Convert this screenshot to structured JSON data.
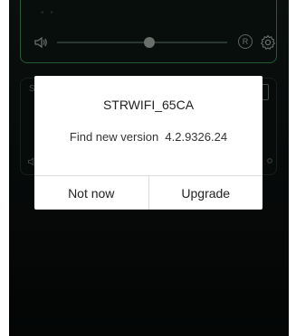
{
  "dialog": {
    "title": "STRWIFI_65CA",
    "message": "Find new version  4.2.9326.24",
    "buttons": {
      "not_now": "Not now",
      "upgrade": "Upgrade"
    }
  },
  "device_card": {
    "badge": "R",
    "volume_fraction": 0.62,
    "icons": [
      "speaker-icon",
      "repeat-badge-icon",
      "gear-icon"
    ]
  },
  "background_card": {
    "label_partial": "Sc"
  },
  "colors": {
    "card_border": "#2f7a48",
    "background": "#0a0f0e",
    "dialog_bg": "#ffffff"
  }
}
